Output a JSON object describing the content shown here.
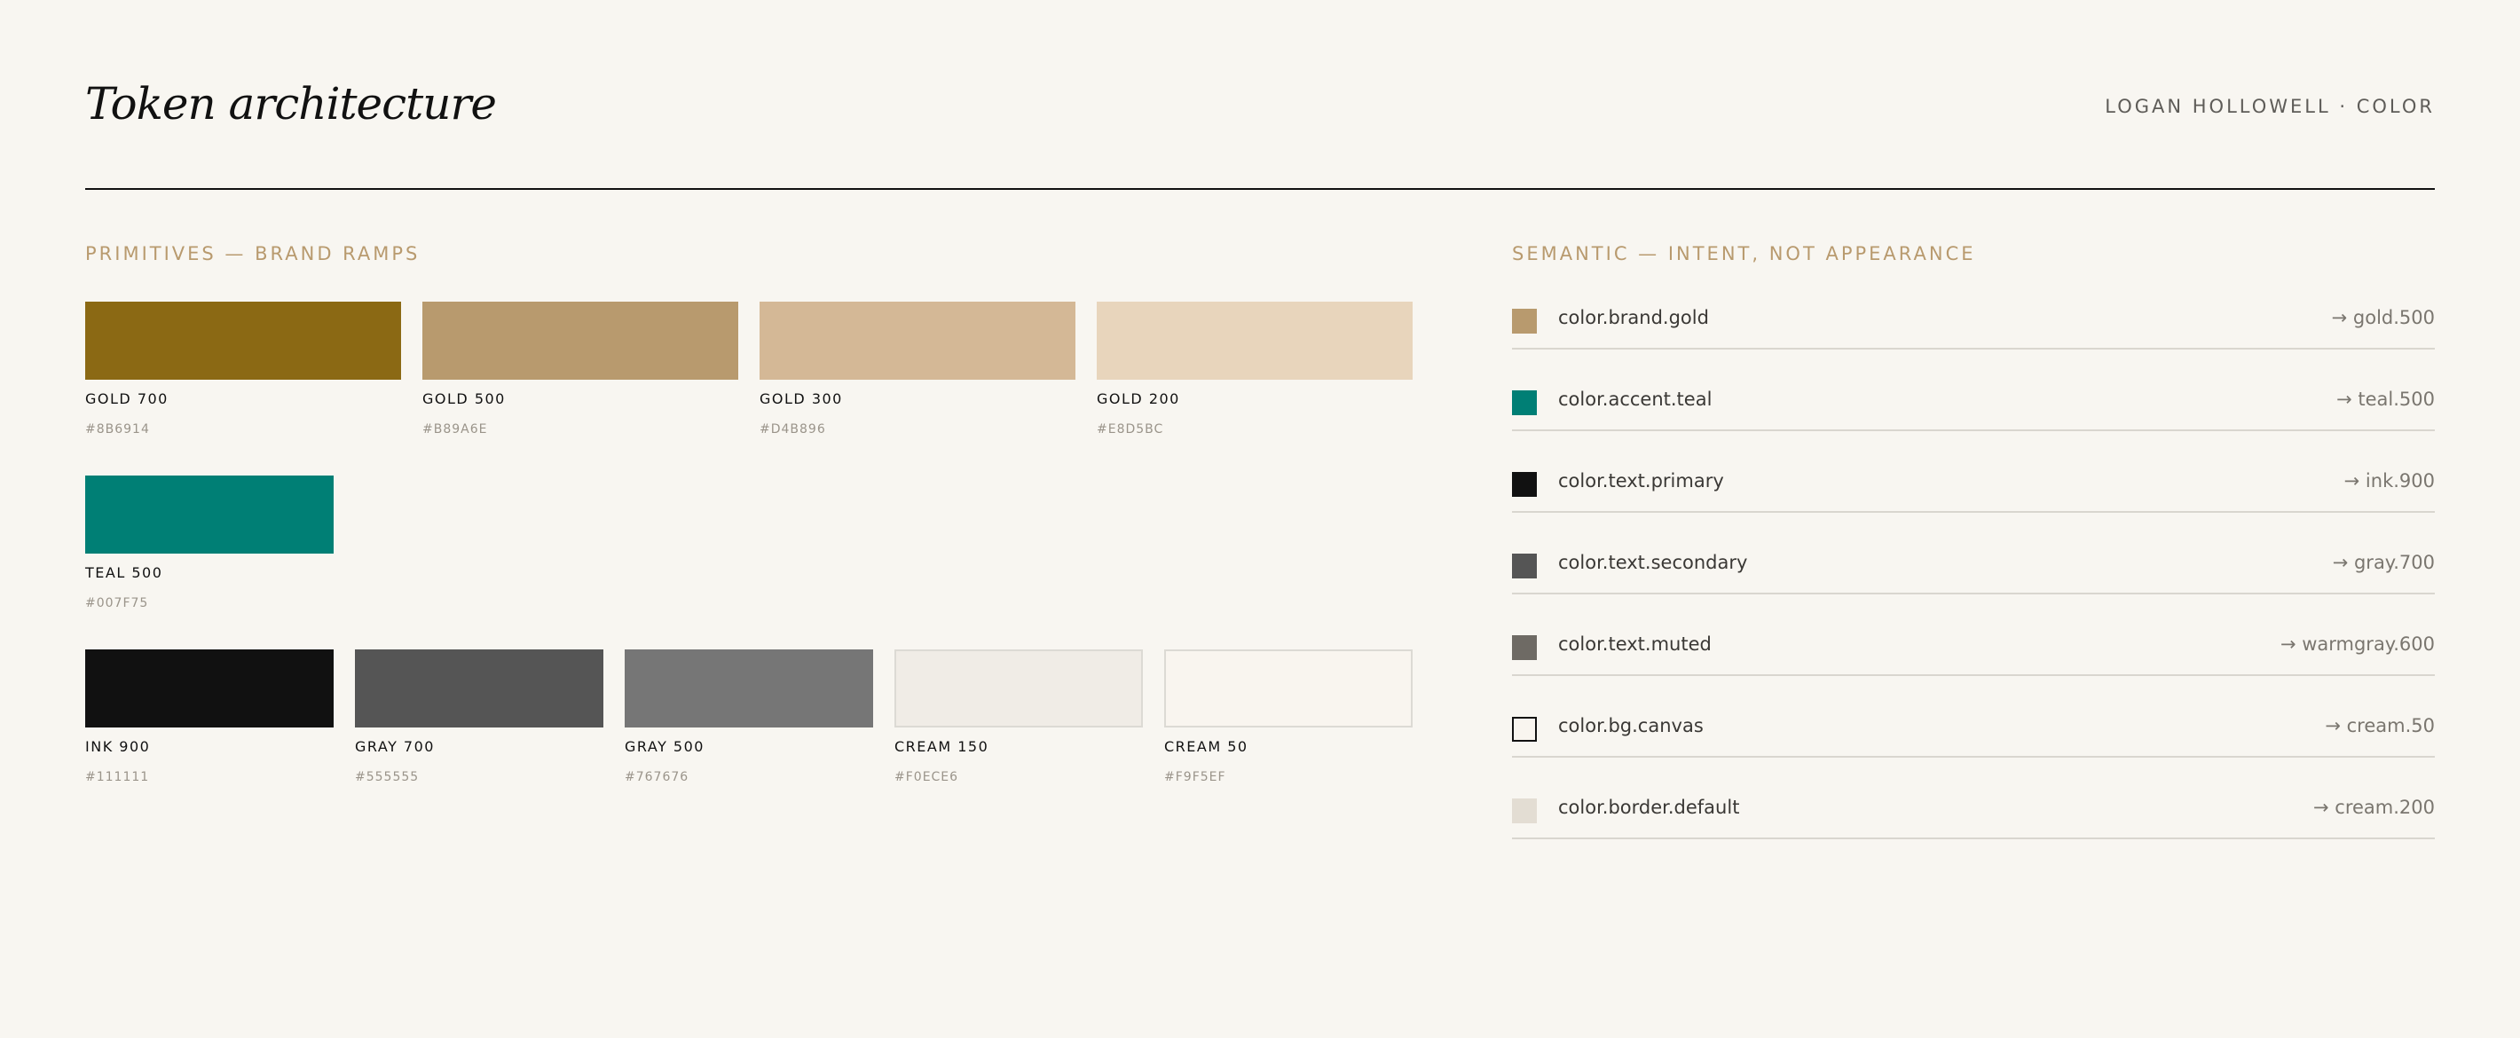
{
  "header": {
    "title": "Token architecture",
    "byline": "LOGAN HOLLOWELL · COLOR"
  },
  "primitives": {
    "label": "PRIMITIVES — BRAND RAMPS",
    "gold": [
      {
        "name": "GOLD 700",
        "hex": "#8B6914",
        "color": "#8B6914"
      },
      {
        "name": "GOLD 500",
        "hex": "#B89A6E",
        "color": "#B89A6E"
      },
      {
        "name": "GOLD 300",
        "hex": "#D4B896",
        "color": "#D4B896"
      },
      {
        "name": "GOLD 200",
        "hex": "#E8D5BC",
        "color": "#E8D5BC"
      }
    ],
    "teal": [
      {
        "name": "TEAL 500",
        "hex": "#007F75",
        "color": "#007F75"
      }
    ],
    "neutral": [
      {
        "name": "INK 900",
        "hex": "#111111",
        "color": "#111111"
      },
      {
        "name": "GRAY 700",
        "hex": "#555555",
        "color": "#555555"
      },
      {
        "name": "GRAY 500",
        "hex": "#767676",
        "color": "#767676"
      },
      {
        "name": "CREAM 150",
        "hex": "#F0ECE6",
        "color": "#F0ECE6"
      },
      {
        "name": "CREAM 50",
        "hex": "#F9F5EF",
        "color": "#F9F5EF"
      }
    ]
  },
  "semantic": {
    "label": "SEMANTIC — INTENT, NOT APPEARANCE",
    "tokens": [
      {
        "name": "color.brand.gold",
        "ref": "→ gold.500",
        "color": "#B89A6E"
      },
      {
        "name": "color.accent.teal",
        "ref": "→ teal.500",
        "color": "#007F75"
      },
      {
        "name": "color.text.primary",
        "ref": "→ ink.900",
        "color": "#111111"
      },
      {
        "name": "color.text.secondary",
        "ref": "→ gray.700",
        "color": "#555555"
      },
      {
        "name": "color.text.muted",
        "ref": "→ warmgray.600",
        "color": "#6E6A64"
      },
      {
        "name": "color.bg.canvas",
        "ref": "→ cream.50",
        "color": "#F9F5EF"
      },
      {
        "name": "color.border.default",
        "ref": "→ cream.200",
        "color": "#E3DDD3"
      }
    ]
  }
}
